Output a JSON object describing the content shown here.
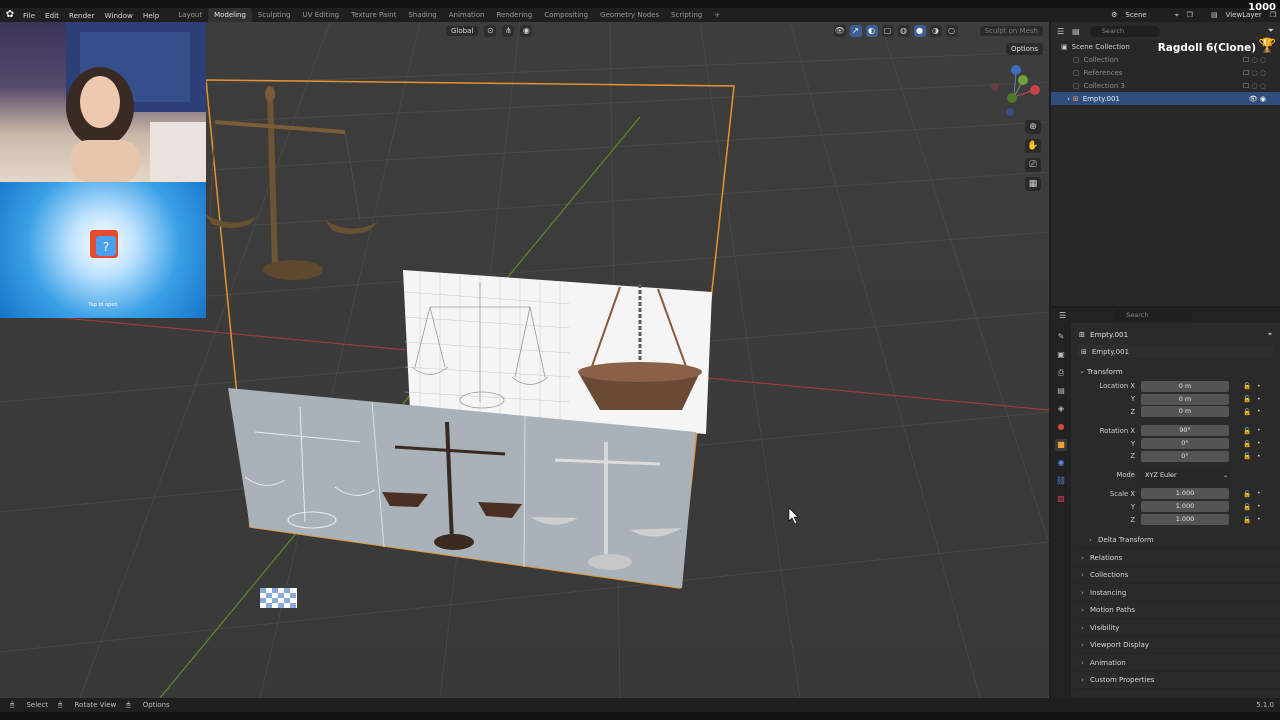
{
  "menu": {
    "items": [
      "File",
      "Edit",
      "Render",
      "Window",
      "Help"
    ]
  },
  "workspaces": {
    "tabs": [
      "Layout",
      "Modeling",
      "Sculpting",
      "UV Editing",
      "Texture Paint",
      "Shading",
      "Animation",
      "Rendering",
      "Compositing",
      "Geometry Nodes",
      "Scripting"
    ],
    "active": "Modeling",
    "add": "+"
  },
  "topright": {
    "scene": "Scene",
    "view_layer": "ViewLayer"
  },
  "viewport": {
    "transform_orientation": "Global",
    "sculpt_label": "Sculpt on Mesh",
    "options_label": "Options"
  },
  "overlay": {
    "tap_text": "Tap to open",
    "ragdoll": "Ragdoll 6(Clone)",
    "count": "1000"
  },
  "outliner": {
    "search_placeholder": "Search",
    "root": "Scene Collection",
    "items": [
      {
        "name": "Collection"
      },
      {
        "name": "References"
      },
      {
        "name": "Collection 3"
      },
      {
        "name": "Empty.001"
      }
    ]
  },
  "properties": {
    "search_placeholder": "Search",
    "object_name": "Empty.001",
    "object_field": "Empty.001",
    "transform_label": "Transform",
    "location_label": "Location X",
    "location": [
      "0 m",
      "0 m",
      "0 m"
    ],
    "rotation_label": "Rotation X",
    "rotation": [
      "90°",
      "0°",
      "0°"
    ],
    "mode_label": "Mode",
    "mode_value": "XYZ Euler",
    "scale_label": "Scale X",
    "scale": [
      "1.000",
      "1.000",
      "1.000"
    ],
    "axis_y": "Y",
    "axis_z": "Z",
    "delta_transform": "Delta Transform",
    "panels": [
      "Relations",
      "Collections",
      "Instancing",
      "Motion Paths",
      "Visibility",
      "Viewport Display",
      "Animation",
      "Custom Properties"
    ]
  },
  "statusbar": {
    "select": "Select",
    "rotate_view": "Rotate View",
    "options": "Options",
    "version": "5.1.0"
  },
  "colors": {
    "accent_selection": "#2f4d7d",
    "object_outline": "#e8912f",
    "x_axis": "#b0413e",
    "y_axis": "#6e9a2d"
  }
}
